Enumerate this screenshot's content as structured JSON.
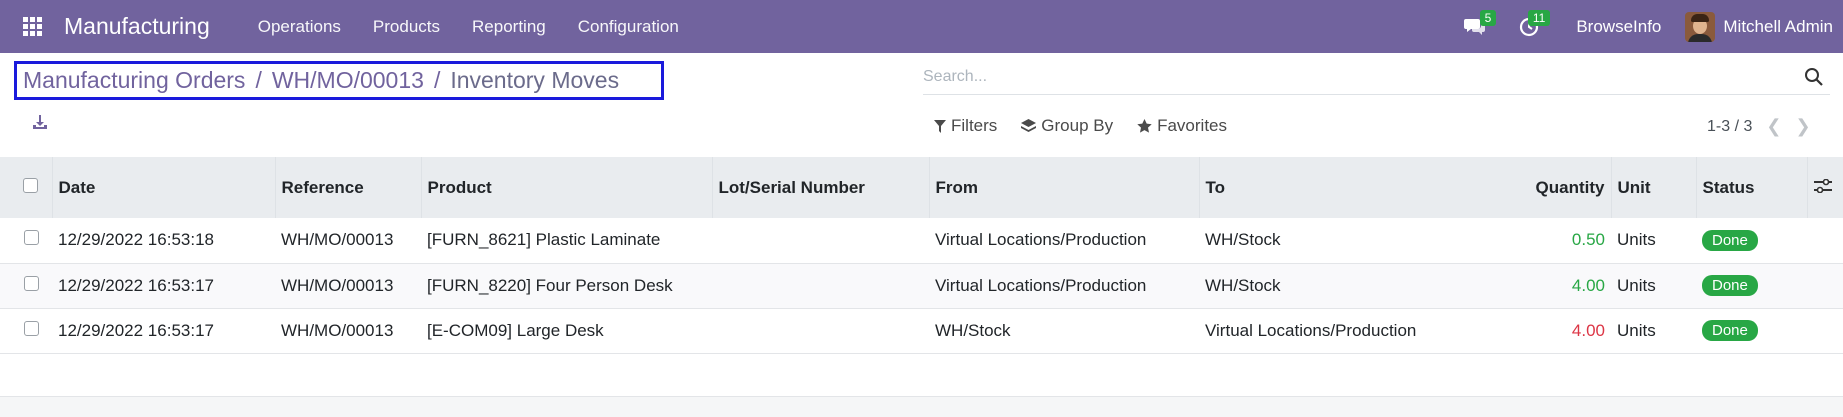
{
  "navbar": {
    "app_name": "Manufacturing",
    "menu": [
      "Operations",
      "Products",
      "Reporting",
      "Configuration"
    ],
    "messages_badge": "5",
    "activities_badge": "11",
    "company": "BrowseInfo",
    "user": "Mitchell Admin",
    "color": "#71639e"
  },
  "breadcrumb": {
    "items": [
      "Manufacturing Orders",
      "WH/MO/00013",
      "Inventory Moves"
    ],
    "separator": "/"
  },
  "search": {
    "placeholder": "Search..."
  },
  "filters": {
    "filters_label": "Filters",
    "group_by_label": "Group By",
    "favorites_label": "Favorites"
  },
  "pager": {
    "value": "1-3 / 3"
  },
  "table": {
    "columns": [
      "Date",
      "Reference",
      "Product",
      "Lot/Serial Number",
      "From",
      "To",
      "Quantity",
      "Unit",
      "Status"
    ],
    "rows": [
      {
        "date": "12/29/2022 16:53:18",
        "reference": "WH/MO/00013",
        "product": "[FURN_8621] Plastic Laminate",
        "lot": "",
        "from": "Virtual Locations/Production",
        "to": "WH/Stock",
        "quantity": "0.50",
        "unit": "Units",
        "status": "Done",
        "qty_color": "#28a745"
      },
      {
        "date": "12/29/2022 16:53:17",
        "reference": "WH/MO/00013",
        "product": "[FURN_8220] Four Person Desk",
        "lot": "",
        "from": "Virtual Locations/Production",
        "to": "WH/Stock",
        "quantity": "4.00",
        "unit": "Units",
        "status": "Done",
        "qty_color": "#28a745"
      },
      {
        "date": "12/29/2022 16:53:17",
        "reference": "WH/MO/00013",
        "product": "[E-COM09] Large Desk",
        "lot": "",
        "from": "WH/Stock",
        "to": "Virtual Locations/Production",
        "quantity": "4.00",
        "unit": "Units",
        "status": "Done",
        "qty_color": "#dc3545"
      }
    ]
  }
}
